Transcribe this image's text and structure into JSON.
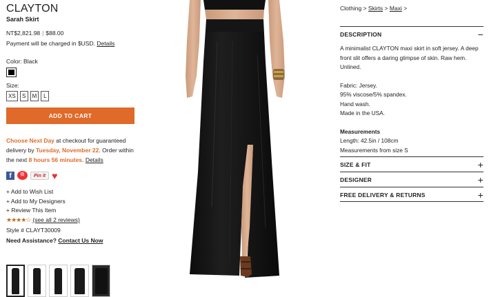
{
  "product": {
    "brand": "CLAYTON",
    "name": "Sarah Skirt",
    "price_local": "NT$2,821.98",
    "price_separator": "|",
    "price_usd": "$88.00",
    "charged_text": "Payment will be charged in $USD.",
    "details_link": "Details"
  },
  "color": {
    "label": "Color: Black",
    "swatch_hex": "#000000"
  },
  "size": {
    "label": "Size:",
    "options": [
      "XS",
      "S",
      "M",
      "L"
    ]
  },
  "cart_button": "ADD TO CART",
  "shipping": {
    "promo": "Choose Next Day",
    "text1": " at checkout for guaranteed delivery by ",
    "date": "Tuesday, November 22",
    "text2": ". Order within the next ",
    "countdown": "8 hours 56 minutes",
    "text3": ". ",
    "details_link": "Details"
  },
  "social": {
    "facebook": "f",
    "weibo": "微",
    "pinterest": "Pin it",
    "heart": "♥",
    "accent_hex": "#e06a2a"
  },
  "actions": [
    "+ Add to Wish List",
    "+ Add to My Designers",
    "+ Review This Item"
  ],
  "rating": {
    "stars": "★★★★☆",
    "value_of_5": 4,
    "reviews_link": "(see all 2 reviews)"
  },
  "style_number": "Style # CLAYT30009",
  "assistance": {
    "label": "Need Assistance?",
    "link": "Contact Us Now"
  },
  "thumbnails": 5,
  "breadcrumb": {
    "root": "Clothing",
    "sep": ">",
    "level1": "Skirts",
    "level2": "Maxi",
    "trail": ">"
  },
  "accordion": {
    "description": {
      "title": "DESCRIPTION",
      "toggle": "−",
      "intro": "A minimalist CLAYTON maxi skirt in soft jersey. A deep front slit offers a daring glimpse of skin. Raw hem. Unlined.",
      "fabric": "Fabric: Jersey.",
      "composition": "95% viscose/5% spandex.",
      "care": "Hand wash.",
      "origin": "Made in the USA.",
      "measurements_title": "Measurements",
      "length": "Length: 42.5in / 108cm",
      "from_size": "Measurements from size S"
    },
    "sections": [
      {
        "title": "SIZE & FIT",
        "toggle": "+"
      },
      {
        "title": "DESIGNER",
        "toggle": "+"
      },
      {
        "title": "FREE DELIVERY & RETURNS",
        "toggle": "+"
      }
    ]
  }
}
